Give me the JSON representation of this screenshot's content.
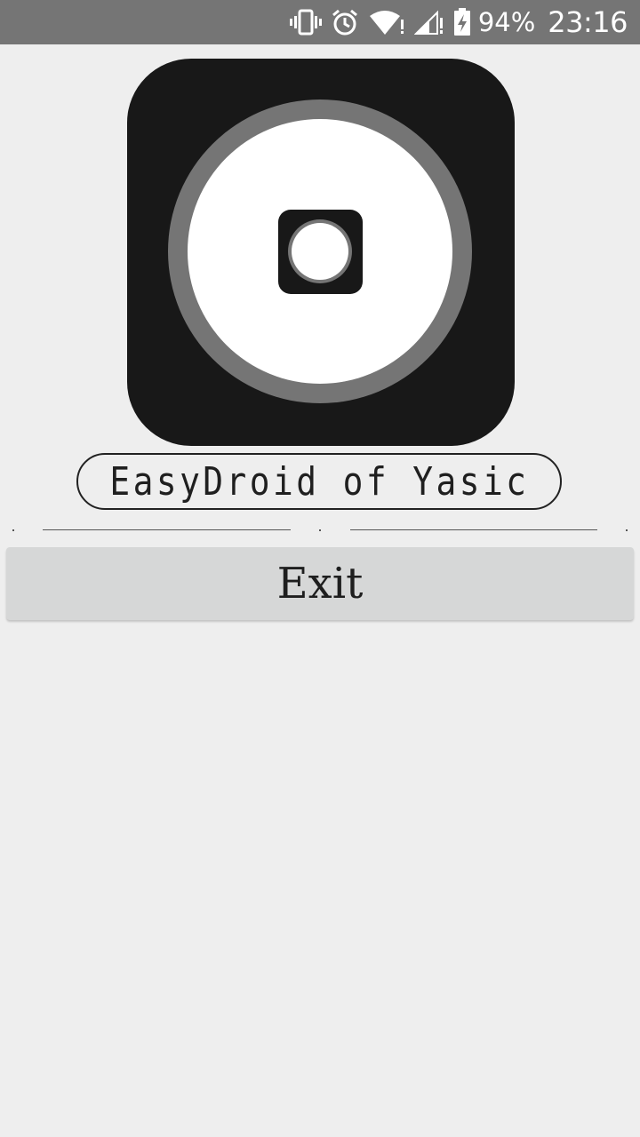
{
  "status_bar": {
    "battery_percent": "94%",
    "time": "23:16",
    "icons": [
      "vibrate-icon",
      "alarm-icon",
      "wifi-icon",
      "signal-icon",
      "battery-charging-icon"
    ]
  },
  "app": {
    "title": "EasyDroid of Yasic",
    "exit_label": "Exit"
  },
  "colors": {
    "status_bar": "#757575",
    "background": "#eeeeee",
    "logo_dark": "#181818",
    "logo_ring": "#757575",
    "button": "#d6d7d7"
  }
}
